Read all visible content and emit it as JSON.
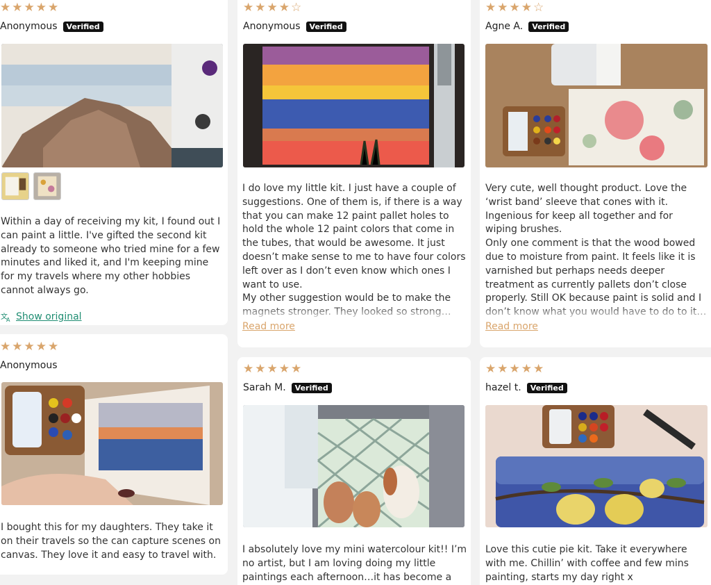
{
  "colors": {
    "star": "#d9a56c",
    "badge_bg": "#111111",
    "link_green": "#1f8d72",
    "read_more": "#d9a56c"
  },
  "reviews": [
    {
      "stars": 5,
      "name": "Anonymous",
      "verified": "Verified",
      "text": "Within a day of receiving my kit, I found out I\ncan paint a little. I've gifted the second kit\nalready to someone who tried mine for a few\nminutes and liked it, and I'm keeping mine\nfor my travels where my other hobbies\ncannot always go.",
      "show_original": "Show original",
      "translate_icon": "translate-icon"
    },
    {
      "stars": 4,
      "name": "Anonymous",
      "verified": "Verified",
      "text": "I do love my little kit. I just have a couple of\nsuggestions. One of them is, if there is a way\nthat you can make 12 paint pallet holes to\nhold the whole 12 paint colors that come in\nthe tubes, that would be awesome. It just\ndoesn’t make sense to me to have four colors\nleft over as I don’t even know which ones I\nwant to use.\nMy other suggestion would be to make the\nmagnets stronger. They looked so strong…",
      "read_more": "Read more"
    },
    {
      "stars": 4,
      "name": "Agne A.",
      "verified": "Verified",
      "text": "Very cute, well thought product. Love the\n‘wrist band’ sleeve that cones with it.\nIngenious for keep all together and for\nwiping brushes.\nOnly one comment is that the wood bowed\ndue to moisture from paint. It feels like it is\nvarnished but perhaps needs deeper\ntreatment as currently pallets don’t close\nproperly. Still OK because paint is solid and I\ndon’t know what you would have to do to it…",
      "read_more": "Read more"
    },
    {
      "stars": 5,
      "name": "Anonymous",
      "text": "I bought this for my daughters. They take it\non their travels so the can capture scenes on\ncanvas. They love it and easy to travel with."
    },
    {
      "stars": 5,
      "name": "Sarah M.",
      "verified": "Verified",
      "text": "I absolutely love my mini watercolour kit!! I’m\nno artist, but I am loving doing my little\npaintings each afternoon…it has become a"
    },
    {
      "stars": 5,
      "name": "hazel t.",
      "verified": "Verified",
      "text": "Love this cutie pie kit. Take it everywhere\nwith me. Chillin’ with coffee and few mins\npainting, starts my day right x"
    }
  ]
}
